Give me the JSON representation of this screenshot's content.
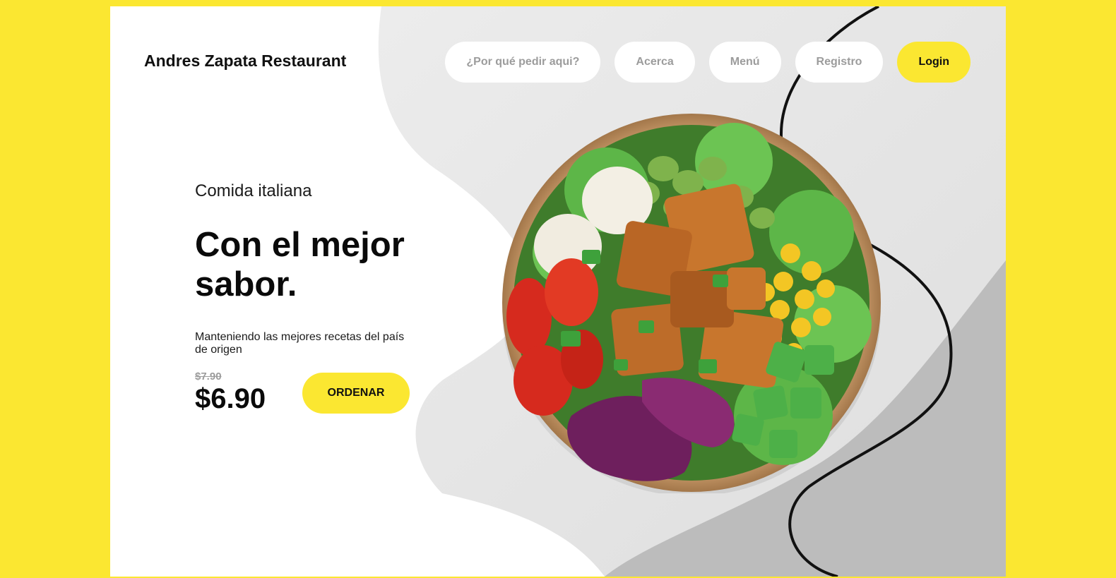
{
  "brand": {
    "name": "Andres Zapata Restaurant"
  },
  "nav": {
    "items": [
      {
        "label": "¿Por qué pedir aqui?"
      },
      {
        "label": "Acerca"
      },
      {
        "label": "Menú"
      },
      {
        "label": "Registro"
      }
    ],
    "login_label": "Login"
  },
  "hero": {
    "eyebrow": "Comida italiana",
    "headline": "Con el mejor sabor.",
    "description": "Manteniendo las mejores recetas del país de origen",
    "old_price": "$7.90",
    "price": "$6.90",
    "cta_label": "ORDENAR"
  },
  "colors": {
    "accent": "#fbe731",
    "background": "#ffffff",
    "muted_text": "#9c9c9c"
  },
  "icons": {
    "hero_image": "salad-bowl"
  }
}
